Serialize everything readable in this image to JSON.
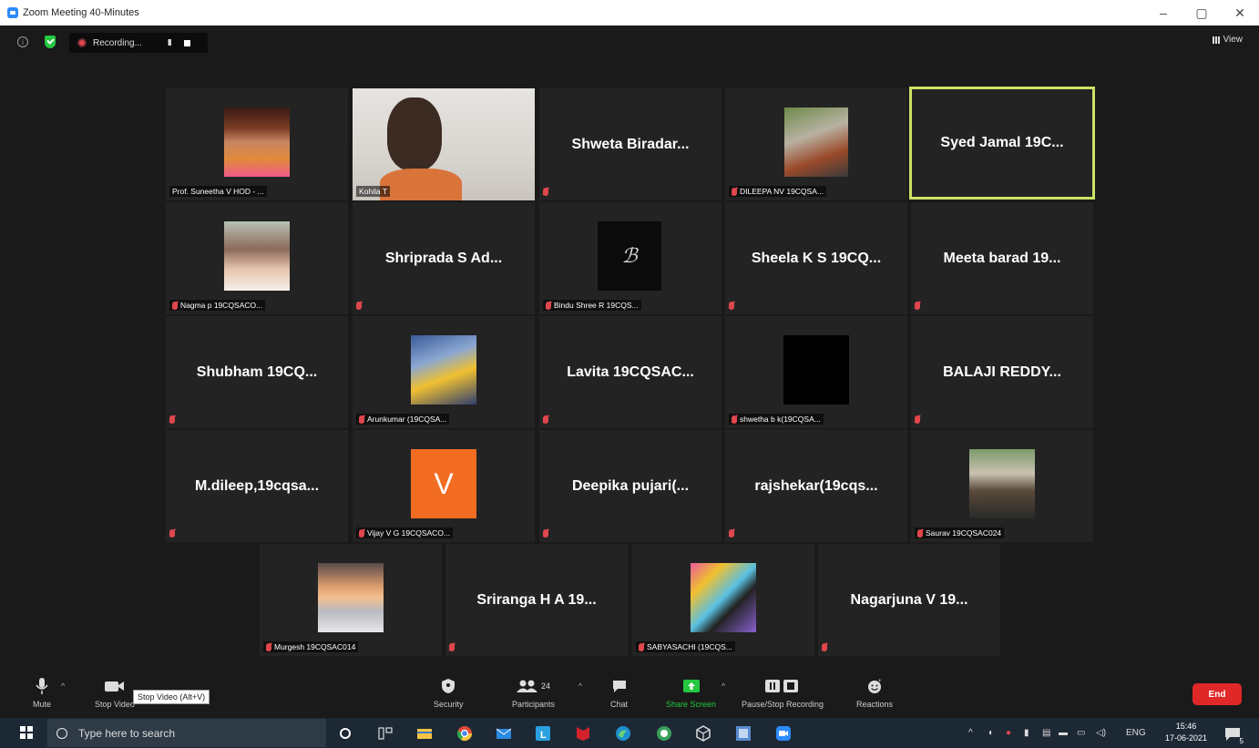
{
  "window": {
    "title": "Zoom Meeting 40-Minutes",
    "minimize": "–",
    "maximize": "▢",
    "close": "✕"
  },
  "topbar": {
    "recording_label": "Recording...",
    "pause_glyph": "II",
    "view_label": "View"
  },
  "tiles": [
    {
      "label": "Prof. Suneetha V HOD - ...",
      "big": ""
    },
    {
      "label": "Kohila T",
      "big": ""
    },
    {
      "label": "",
      "big": "Shweta Biradar..."
    },
    {
      "label": "DILEEPA NV 19CQSA...",
      "big": ""
    },
    {
      "label": "",
      "big": "Syed Jamal 19C..."
    },
    {
      "label": "Nagma p 19CQSACO...",
      "big": ""
    },
    {
      "label": "",
      "big": "Shripradа S Ad..."
    },
    {
      "label": "Bindu Shree R 19CQS...",
      "big": ""
    },
    {
      "label": "",
      "big": "Sheela K S 19CQ..."
    },
    {
      "label": "",
      "big": "Meeta barad 19..."
    },
    {
      "label": "",
      "big": "Shubham 19CQ..."
    },
    {
      "label": "Arunkumar (19CQSA...",
      "big": ""
    },
    {
      "label": "",
      "big": "Lavita 19CQSAC..."
    },
    {
      "label": "shwetha b k(19CQSA...",
      "big": ""
    },
    {
      "label": "",
      "big": "BALAJI REDDY..."
    },
    {
      "label": "",
      "big": "M.dileep,19cqsa..."
    },
    {
      "label": "Vijay V G 19CQSACO...",
      "big": "",
      "avatar_letter": "V"
    },
    {
      "label": "",
      "big": "Deepika pujari(..."
    },
    {
      "label": "",
      "big": "rajshekar(19cqs..."
    },
    {
      "label": "Saurav 19CQSAC024",
      "big": ""
    },
    {
      "label": "Murgesh 19CQSAC014",
      "big": ""
    },
    {
      "label": "",
      "big": "Sriranga H A 19..."
    },
    {
      "label": "SABYASACHI (19CQS...",
      "big": ""
    },
    {
      "label": "",
      "big": "Nagarjuna V 19..."
    }
  ],
  "toolbar": {
    "mute": "Mute",
    "stop_video": "Stop Video",
    "tooltip": "Stop Video (Alt+V)",
    "security": "Security",
    "participants": "Participants",
    "participants_count": "24",
    "chat": "Chat",
    "share_screen": "Share Screen",
    "pause_stop_recording": "Pause/Stop Recording",
    "reactions": "Reactions",
    "end": "End"
  },
  "taskbar": {
    "search_placeholder": "Type here to search",
    "language": "ENG",
    "time": "15:46",
    "date": "17-06-2021",
    "notification_count": "5"
  },
  "colors": {
    "active_speaker": "#c9e265",
    "share_green": "#25c840",
    "end_red": "#e02828",
    "muted_red": "#e0474d",
    "avatar_orange": "#f26d21"
  }
}
